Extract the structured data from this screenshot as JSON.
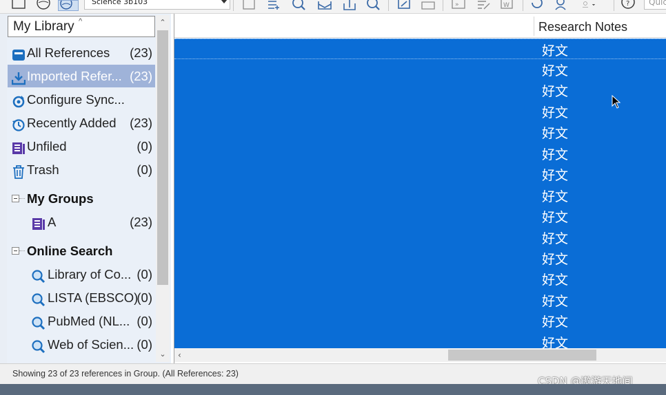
{
  "toolbar": {
    "style_value": "Science 3b103",
    "quick_search_placeholder": "Quic",
    "icons": [
      "window-icon",
      "globe-icon",
      "online-globe-icon",
      "new-reference-icon",
      "insert-reference-icon",
      "find-full-text-icon",
      "email-icon",
      "export-icon",
      "search-icon",
      "link-icon",
      "folder-icon",
      "quote-icon",
      "edit-icon",
      "word-icon",
      "sync-icon",
      "share-icon",
      "user-icon",
      "help-icon"
    ]
  },
  "library": {
    "header": "My Library",
    "items": [
      {
        "label": "All References",
        "count": "(23)",
        "icon": "all-references-icon"
      },
      {
        "label": "Imported Refer...",
        "count": "(23)",
        "icon": "imported-references-icon",
        "selected": true
      },
      {
        "label": "Configure Sync...",
        "count": "",
        "icon": "sync-icon"
      },
      {
        "label": "Recently Added",
        "count": "(23)",
        "icon": "recently-added-icon"
      },
      {
        "label": "Unfiled",
        "count": "(0)",
        "icon": "unfiled-icon"
      },
      {
        "label": "Trash",
        "count": "(0)",
        "icon": "trash-icon"
      }
    ],
    "my_groups": {
      "title": "My Groups",
      "items": [
        {
          "label": "A",
          "count": "(23)",
          "icon": "group-icon"
        }
      ]
    },
    "online_search": {
      "title": "Online Search",
      "items": [
        {
          "label": "Library of Co...",
          "count": "(0)",
          "icon": "online-search-icon"
        },
        {
          "label": "LISTA (EBSCO)",
          "count": "(0)",
          "icon": "online-search-icon"
        },
        {
          "label": "PubMed (NL...",
          "count": "(0)",
          "icon": "online-search-icon"
        },
        {
          "label": "Web of Scien...",
          "count": "(0)",
          "icon": "online-search-icon"
        }
      ]
    }
  },
  "references": {
    "column_header": "Research Notes",
    "notes": [
      "好文",
      "好文",
      "好文",
      "好文",
      "好文",
      "好文",
      "好文",
      "好文",
      "好文",
      "好文",
      "好文",
      "好文",
      "好文",
      "好文",
      "好文"
    ]
  },
  "status": {
    "text": "Showing 23 of 23 references in Group. (All References: 23)"
  },
  "watermark": "CSDN @遨游天地间",
  "colors": {
    "selection_blue": "#0a6dd6",
    "left_panel_bg": "#eaf0f8",
    "selected_group_bg": "#9fb3d9",
    "icon_blue": "#1d6fbf",
    "icon_purple": "#5a3aa8"
  }
}
